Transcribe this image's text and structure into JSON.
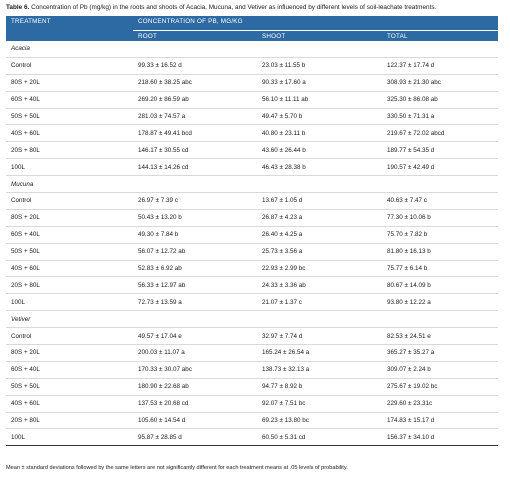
{
  "caption": {
    "label": "Table 6.",
    "text": "Concentration of Pb (mg/kg) in the roots and shoots of Acacia, Mucuna, and Vetiver as influenced by different levels of soil-leachate treatments."
  },
  "headers": {
    "treatment": "TREATMENT",
    "group": "CONCENTRATION OF PB, MG/KG",
    "root": "ROOT",
    "shoot": "SHOOT",
    "total": "TOTAL"
  },
  "groups": [
    {
      "name": "Acacia",
      "rows": [
        {
          "treatment": "Control",
          "root": "99.33 ± 16.52 d",
          "shoot": "23.03 ± 11.55 b",
          "total": "122.37 ± 17.74 d"
        },
        {
          "treatment": "80S + 20L",
          "root": "218.60 ± 38.25 abc",
          "shoot": "90.33 ± 17.60 a",
          "total": "308.93 ± 21.30 abc"
        },
        {
          "treatment": "60S + 40L",
          "root": "269.20 ± 86.59 ab",
          "shoot": "56.10 ± 11.11 ab",
          "total": "325.30 ± 86.08 ab"
        },
        {
          "treatment": "50S + 50L",
          "root": "281.03 ± 74.57 a",
          "shoot": "49.47 ± 5.70 b",
          "total": "330.50 ± 71.31 a"
        },
        {
          "treatment": "40S + 60L",
          "root": "178.87 ± 49.41 bcd",
          "shoot": "40.80 ± 23.11 b",
          "total": "219.67 ± 72.02 abcd"
        },
        {
          "treatment": "20S + 80L",
          "root": "146.17 ± 30.55 cd",
          "shoot": "43.60 ± 26.44 b",
          "total": "189.77 ± 54.35 d"
        },
        {
          "treatment": "100L",
          "root": "144.13 ± 14.26 cd",
          "shoot": "46.43 ± 28.38 b",
          "total": "190.57 ± 42.49 d"
        }
      ]
    },
    {
      "name": "Mucuna",
      "rows": [
        {
          "treatment": "Control",
          "root": "26.97 ± 7.39 c",
          "shoot": "13.67 ± 1.05 d",
          "total": "40.63 ± 7.47 c"
        },
        {
          "treatment": "80S + 20L",
          "root": "50.43 ± 13.20 b",
          "shoot": "26.87 ± 4.23 a",
          "total": "77.30 ± 10.06 b"
        },
        {
          "treatment": "60S + 40L",
          "root": "49.30 ± 7.84 b",
          "shoot": "26.40 ± 4.25 a",
          "total": "75.70 ± 7.82 b"
        },
        {
          "treatment": "50S + 50L",
          "root": "56.07 ± 12.72 ab",
          "shoot": "25.73 ± 3.56 a",
          "total": "81.80 ± 16.13 b"
        },
        {
          "treatment": "40S + 60L",
          "root": "52.83 ± 6.92 ab",
          "shoot": "22.93 ± 2.99 bc",
          "total": "75.77 ± 6.14 b"
        },
        {
          "treatment": "20S + 80L",
          "root": "56.33 ± 12.97 ab",
          "shoot": "24.33 ± 3.36 ab",
          "total": "80.67 ± 14.09 b"
        },
        {
          "treatment": "100L",
          "root": "72.73 ± 13.59 a",
          "shoot": "21.07 ± 1.37 c",
          "total": "93.80 ± 12.22 a"
        }
      ]
    },
    {
      "name": "Vetiver",
      "rows": [
        {
          "treatment": "Control",
          "root": "49.57 ± 17.04 e",
          "shoot": "32.97 ± 7.74 d",
          "total": "82.53 ± 24.51 e"
        },
        {
          "treatment": "80S + 20L",
          "root": "200.03 ± 11.07 a",
          "shoot": "165.24 ± 26.54 a",
          "total": "365.27 ± 35.27 a"
        },
        {
          "treatment": "60S + 40L",
          "root": "170.33 ± 30.07 abc",
          "shoot": "138.73 ± 32.13 a",
          "total": "309.07 ± 2.24 b"
        },
        {
          "treatment": "50S + 50L",
          "root": "180.90 ± 22.68 ab",
          "shoot": "94.77 ± 8.92 b",
          "total": "275.67 ± 19.02 bc"
        },
        {
          "treatment": "40S + 60L",
          "root": "137.53 ± 20.68 cd",
          "shoot": "92.07 ± 7.51 bc",
          "total": "229.60 ± 23.31c"
        },
        {
          "treatment": "20S + 80L",
          "root": "105.60 ± 14.54 d",
          "shoot": "69.23 ± 13.80 bc",
          "total": "174.83 ± 15.17 d"
        },
        {
          "treatment": "100L",
          "root": "95.87 ± 28.85 d",
          "shoot": "60.50 ± 5.31 cd",
          "total": "156.37 ± 34.10 d"
        }
      ]
    }
  ],
  "footnote": "Mean ± standard deviations followed by the same letters are not significantly different for each treatment means at .05 levels of probability."
}
